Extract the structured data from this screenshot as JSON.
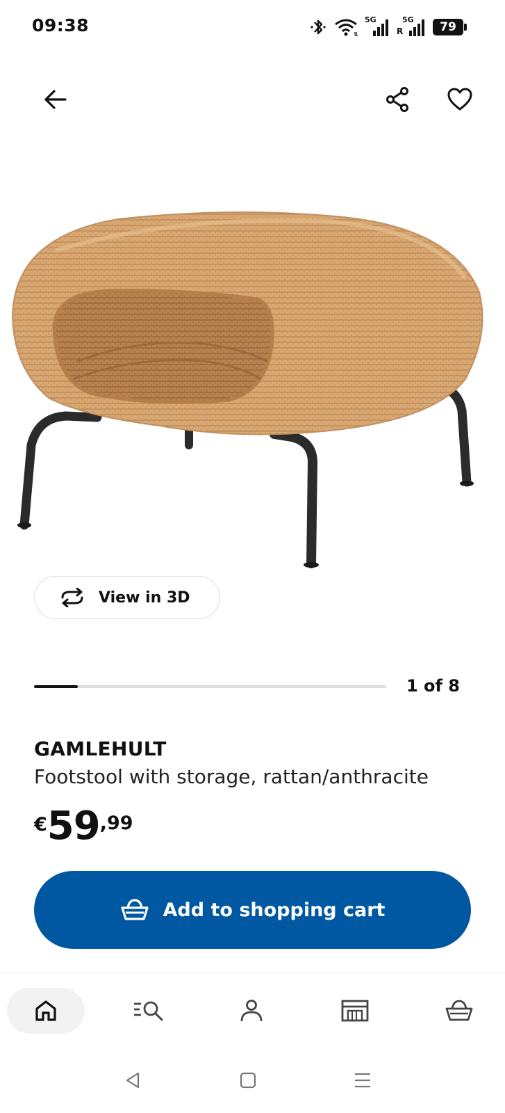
{
  "status_bar": {
    "time": "09:38",
    "battery": "79",
    "signal_1_label": "5G",
    "signal_2_label": "5G",
    "roaming_label": "R",
    "icons": [
      "bluetooth-icon",
      "wifi-icon",
      "signal-icon",
      "signal-roaming-icon",
      "battery-icon"
    ]
  },
  "top_nav": {
    "icons": [
      "back-arrow-icon",
      "share-icon",
      "heart-icon"
    ]
  },
  "product_image": {
    "icon": "footstool-image"
  },
  "view_3d": {
    "label": "View in 3D",
    "icon": "rotate-3d-icon"
  },
  "carousel": {
    "counter": "1 of 8",
    "current": 1,
    "total": 8
  },
  "product": {
    "name": "GAMLEHULT",
    "description": "Footstool with storage, rattan/anthracite",
    "price_currency": "€",
    "price_integer": "59",
    "price_decimal": ",99"
  },
  "add_to_cart": {
    "label": "Add to shopping cart",
    "icon": "basket-icon",
    "color": "#0058a3"
  },
  "bottom_nav": {
    "items": [
      {
        "name": "home",
        "icon": "home-icon",
        "active": true
      },
      {
        "name": "search",
        "icon": "search-icon",
        "active": false
      },
      {
        "name": "profile",
        "icon": "profile-icon",
        "active": false
      },
      {
        "name": "store",
        "icon": "store-icon",
        "active": false
      },
      {
        "name": "cart",
        "icon": "basket-icon",
        "active": false
      }
    ]
  },
  "system_nav": {
    "icons": [
      "back-triangle-icon",
      "home-square-icon",
      "menu-lines-icon"
    ]
  }
}
